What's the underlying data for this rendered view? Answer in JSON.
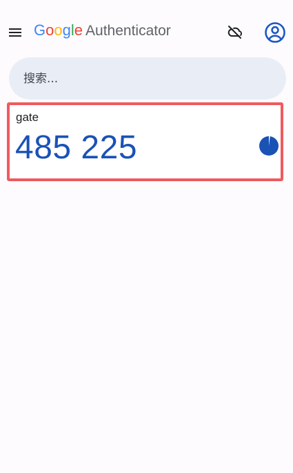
{
  "header": {
    "brand_google": [
      "G",
      "o",
      "o",
      "g",
      "l",
      "e"
    ],
    "brand_product": "Authenticator",
    "brand_colors": [
      "#4285f4",
      "#ea4335",
      "#fbbc05",
      "#4285f4",
      "#34a853",
      "#ea4335"
    ],
    "icons": {
      "menu": "hamburger-menu-icon",
      "cloud": "cloud-off-icon",
      "account": "account-circle-icon"
    }
  },
  "search": {
    "placeholder": "搜索..."
  },
  "accounts": [
    {
      "issuer": "gate",
      "code": "485 225",
      "timer_remaining_fraction": 0.98,
      "highlight_color": "#ee5a5f",
      "code_color": "#1a52b6"
    }
  ]
}
